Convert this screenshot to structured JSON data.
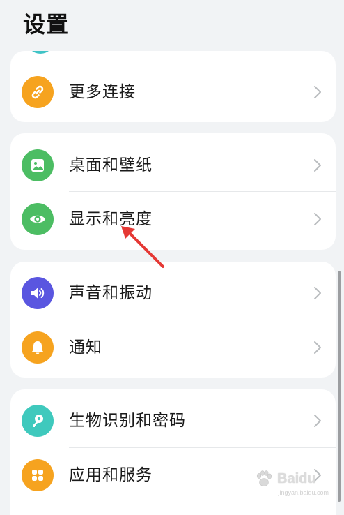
{
  "header": {
    "title": "设置"
  },
  "groups": [
    {
      "items": [
        {
          "label": "更多连接",
          "icon": "link-icon",
          "color": "#f6a31f"
        }
      ]
    },
    {
      "items": [
        {
          "label": "桌面和壁纸",
          "icon": "wallpaper-icon",
          "color": "#4cbd63"
        },
        {
          "label": "显示和亮度",
          "icon": "eye-icon",
          "color": "#4cbd63"
        }
      ]
    },
    {
      "items": [
        {
          "label": "声音和振动",
          "icon": "speaker-icon",
          "color": "#5a56e0"
        },
        {
          "label": "通知",
          "icon": "bell-icon",
          "color": "#f6a31f"
        }
      ]
    },
    {
      "items": [
        {
          "label": "生物识别和密码",
          "icon": "key-icon",
          "color": "#3fc9bd"
        },
        {
          "label": "应用和服务",
          "icon": "apps-icon",
          "color": "#f6a31f"
        }
      ]
    }
  ],
  "watermark": {
    "text": "Baidu",
    "sub": "jingyan.baidu.com"
  },
  "colors": {
    "background": "#f1f3f5",
    "card": "#ffffff",
    "arrow": "#e53935"
  }
}
